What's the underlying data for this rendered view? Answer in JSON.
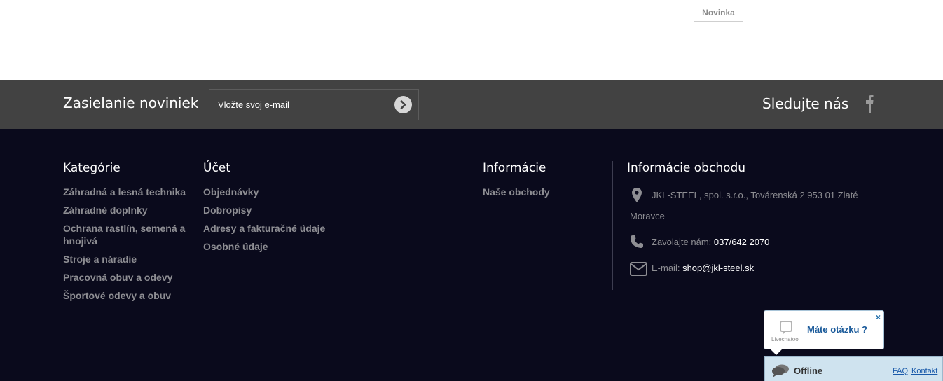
{
  "top": {
    "badge": "Novinka"
  },
  "newsletter": {
    "title": "Zasielanie noviniek",
    "placeholder": "Vložte svoj e-mail",
    "follow": "Sledujte nás"
  },
  "footer": {
    "categories": {
      "title": "Kategórie",
      "items": [
        "Záhradná a lesná technika",
        "Záhradné doplnky",
        "Ochrana rastlín, semená a hnojivá",
        "Stroje a náradie",
        "Pracovná obuv a odevy",
        "Športové odevy a obuv"
      ]
    },
    "account": {
      "title": "Účet",
      "items": [
        "Objednávky",
        "Dobropisy",
        "Adresy a fakturačné údaje",
        "Osobné údaje"
      ]
    },
    "info": {
      "title": "Informácie",
      "items": [
        "Naše obchody"
      ]
    },
    "shop": {
      "title": "Informácie obchodu",
      "address_line1": "JKL-STEEL, spol. s.r.o., Továrenská 2 953 01 Zlaté",
      "address_line2": "Moravce",
      "phone_label": "Zavolajte nám:",
      "phone": "037/642 2070",
      "email_label": "E-mail:",
      "email": "shop@jkl-steel.sk"
    }
  },
  "chat": {
    "close": "×",
    "question": "Máte otázku ?",
    "brand": "Livechatoo",
    "status": "Offline",
    "faq": "FAQ",
    "contact": "Kontakt"
  },
  "icons": {
    "submit": "arrow-right-icon",
    "facebook": "facebook-icon",
    "location": "location-pin-icon",
    "phone": "phone-icon",
    "email": "envelope-icon",
    "chat": "chat-bubbles-icon"
  }
}
